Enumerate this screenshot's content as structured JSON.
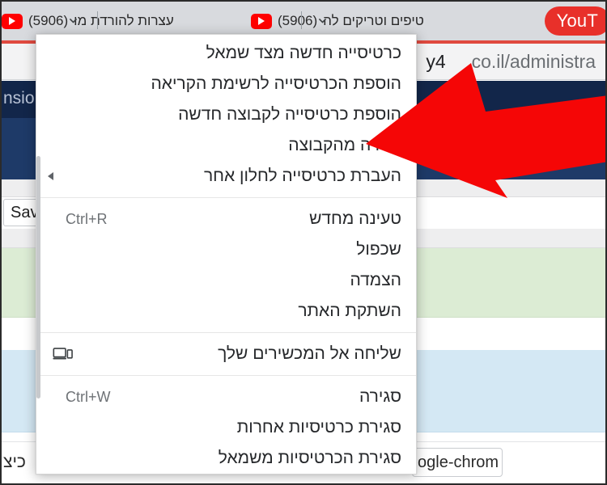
{
  "browser": {
    "tabs": [
      {
        "title": "עצרות להורדת מו",
        "count": "(5906)",
        "favicon": "youtube-favicon"
      },
      {
        "title": "טיפים וטריקים לה",
        "count": "(5906)",
        "favicon": "youtube-favicon"
      }
    ],
    "tab_overflow_label": "YouT",
    "chevron_icon": "chevron-down-icon",
    "omnibox": {
      "url_prefix": "y4",
      "url_suffix": ".co.il/administra",
      "full_text": "y4       .co.il/administra"
    }
  },
  "page": {
    "app_header_text": "nsio",
    "save_button_label": "Sav",
    "bottom_label": "כיצ",
    "chrome_input_value": "ogle-chrom",
    "colors": {
      "header_navy": "#12264a",
      "subheader_navy": "#1e3a68",
      "row_green": "#dcecd4",
      "row_blue": "#d4e8f4",
      "accent_red": "#e04a3f"
    }
  },
  "context_menu": {
    "sections": [
      {
        "items": [
          {
            "label": "כרטיסייה חדשה מצד שמאל",
            "shortcut": "",
            "icon": "",
            "submenu": false
          },
          {
            "label": "הוספת הכרטיסייה לרשימת הקריאה",
            "shortcut": "",
            "icon": "",
            "submenu": false
          },
          {
            "label": "הוספת כרטיסייה לקבוצה חדשה",
            "shortcut": "",
            "icon": "",
            "submenu": false
          },
          {
            "label": "הסרה מהקבוצה",
            "shortcut": "",
            "icon": "",
            "submenu": false
          },
          {
            "label": "העברת כרטיסייה לחלון אחר",
            "shortcut": "",
            "icon": "",
            "submenu": true
          }
        ]
      },
      {
        "items": [
          {
            "label": "טעינה מחדש",
            "shortcut": "Ctrl+R",
            "icon": "",
            "submenu": false
          },
          {
            "label": "שכפול",
            "shortcut": "",
            "icon": "",
            "submenu": false
          },
          {
            "label": "הצמדה",
            "shortcut": "",
            "icon": "",
            "submenu": false
          },
          {
            "label": "השתקת האתר",
            "shortcut": "",
            "icon": "",
            "submenu": false
          }
        ]
      },
      {
        "items": [
          {
            "label": "שליחה אל המכשירים שלך",
            "shortcut": "",
            "icon": "devices-icon",
            "submenu": false
          }
        ]
      },
      {
        "items": [
          {
            "label": "סגירה",
            "shortcut": "Ctrl+W",
            "icon": "",
            "submenu": false
          },
          {
            "label": "סגירת כרטיסיות אחרות",
            "shortcut": "",
            "icon": "",
            "submenu": false
          },
          {
            "label": "סגירת הכרטיסיות משמאל",
            "shortcut": "",
            "icon": "",
            "submenu": false
          }
        ]
      }
    ]
  },
  "annotation": {
    "arrow": {
      "name": "red-pointer-arrow",
      "color": "#f50606",
      "points_at": "הסרה מהקבוצה"
    }
  }
}
